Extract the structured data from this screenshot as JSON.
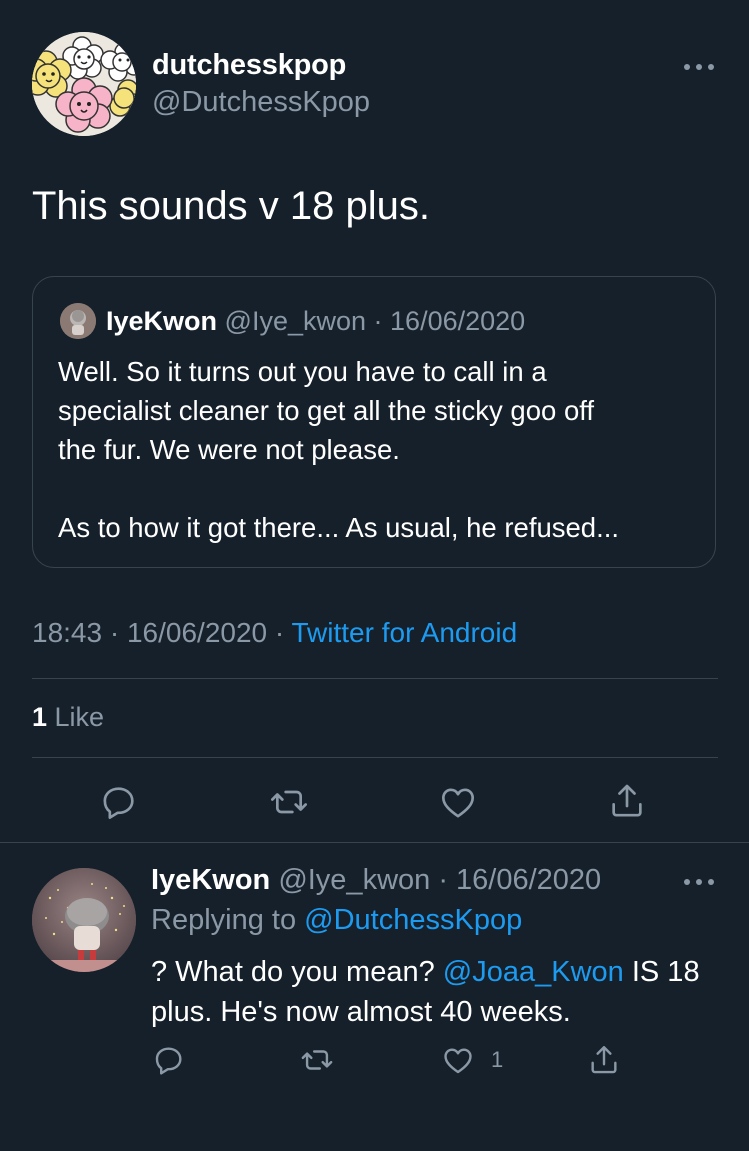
{
  "tweet": {
    "display_name": "dutchesskpop",
    "handle": "@DutchessKpop",
    "text": "This sounds v 18 plus.",
    "quote": {
      "name": "IyeKwon",
      "handle": "@Iye_kwon",
      "date": "16/06/2020",
      "lines": [
        "Well. So it turns out you have to call in a",
        "specialist cleaner to get all the sticky goo off",
        "the fur. We were not please."
      ],
      "last_line": "As to how it got there... As usual, he refused..."
    },
    "time": "18:43",
    "date": "16/06/2020",
    "source": "Twitter for Android",
    "like_count": "1",
    "like_label": " Like"
  },
  "reply": {
    "name": "IyeKwon",
    "handle": "@Iye_kwon",
    "date": "16/06/2020",
    "replying_prefix": "Replying to ",
    "replying_to": "@DutchessKpop",
    "text_before": "? What do you mean? ",
    "mention": "@Joaa_Kwon",
    "text_after_line1": " IS 18",
    "text_line2": "plus. He's now almost 40 weeks.",
    "like_count": "1"
  },
  "separators": {
    "dot": " · "
  },
  "icons": {
    "more": "more-horizontal-icon",
    "reply": "reply-icon",
    "retweet": "retweet-icon",
    "like": "heart-icon",
    "share": "share-icon"
  },
  "colors": {
    "background": "#15202b",
    "accent": "#1d9bf0",
    "muted": "#8b98a5",
    "border": "#38444d"
  }
}
